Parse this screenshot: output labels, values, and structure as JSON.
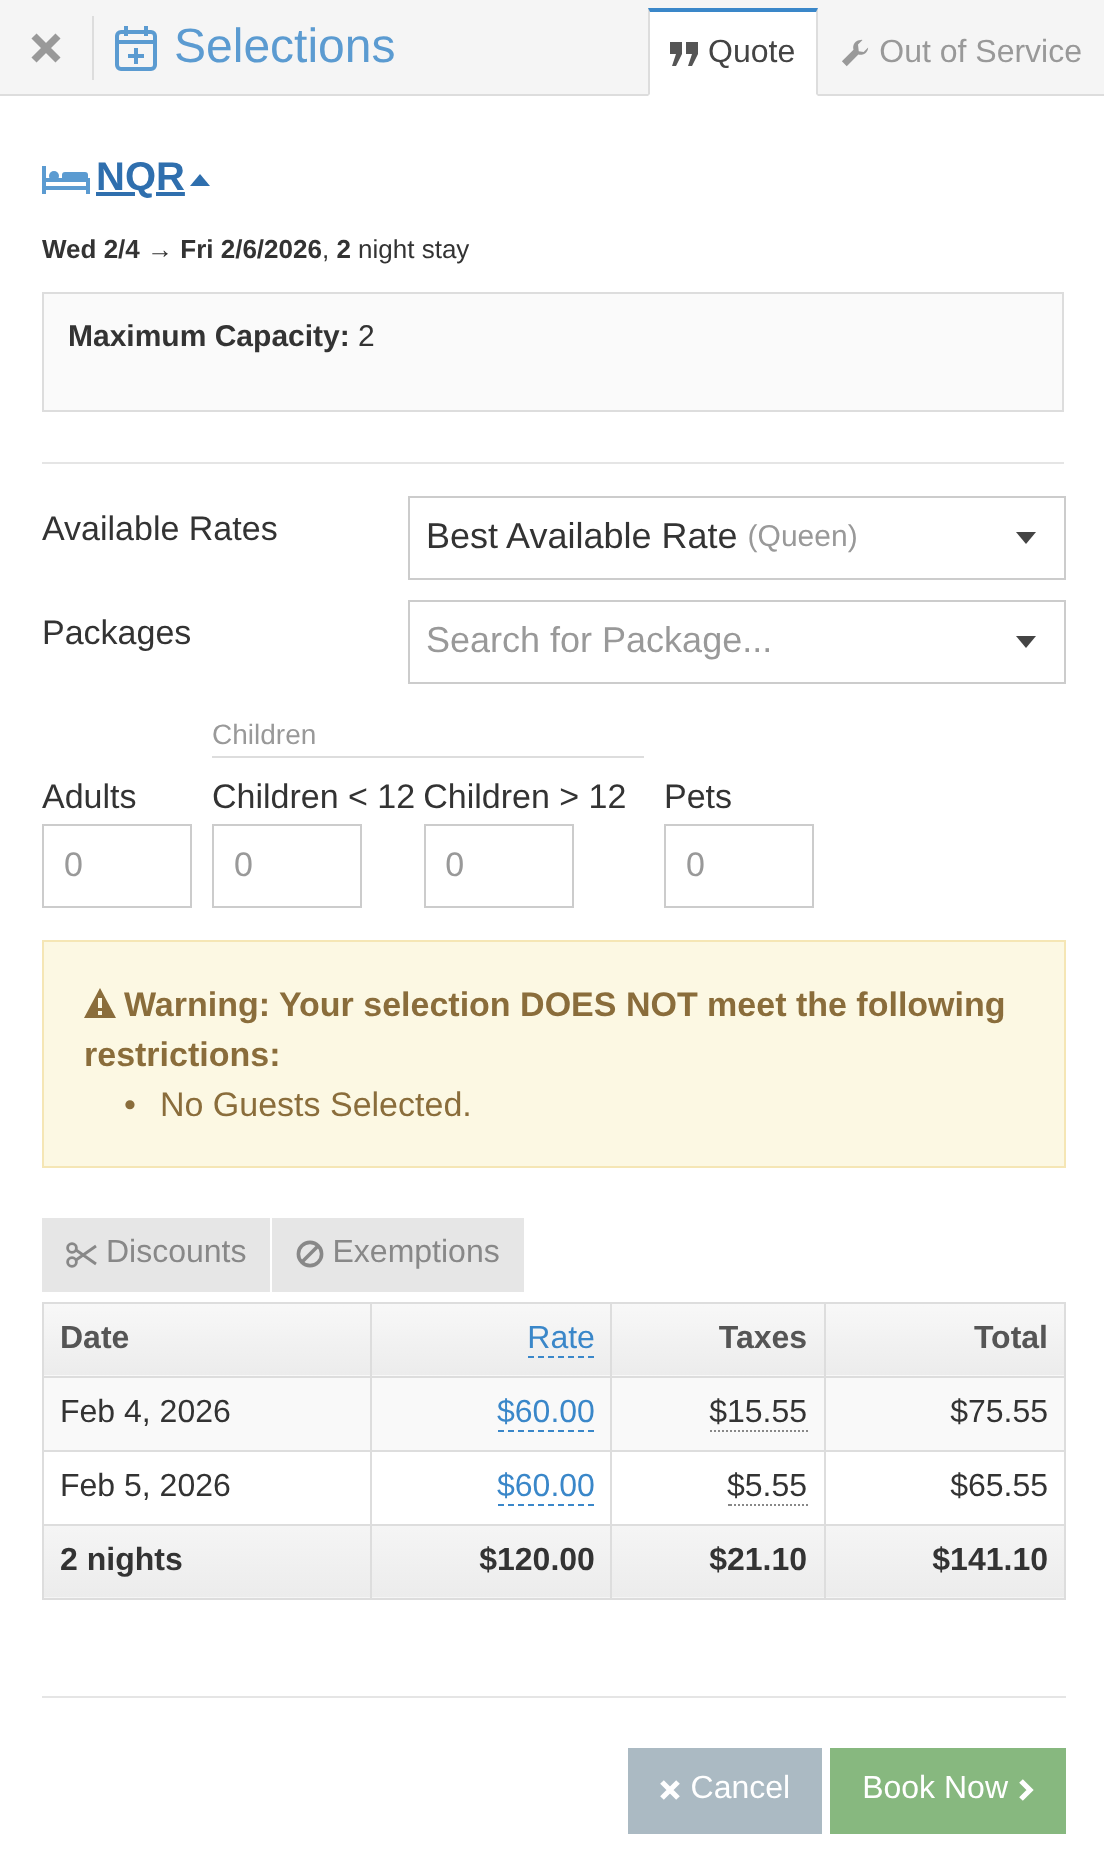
{
  "header": {
    "title": "Selections",
    "tabs": [
      {
        "label": "Quote",
        "selected": true
      },
      {
        "label": "Out of Service",
        "selected": false
      }
    ]
  },
  "room": {
    "name": "NQR",
    "expanded": true,
    "stay": "**Wed 2/4** → **Fri 2/6/2026**, **2** night stay",
    "capacity": "**Maximum Capacity:** 2"
  },
  "fields": [
    {
      "label": "Available Rates",
      "value": "Best Available Rate",
      "hint": "(Queen)"
    },
    {
      "label": "Packages",
      "placeholder": "Search for Package..."
    }
  ],
  "guests": [
    {
      "kind": "single",
      "label": "Adults",
      "placeholder": "0"
    },
    {
      "kind": "group",
      "label": "Children",
      "fields": [
        {
          "label": "Children < 12",
          "placeholder": "0"
        },
        {
          "label": "Children > 12",
          "placeholder": "0"
        }
      ]
    },
    {
      "kind": "single",
      "label": "Pets",
      "placeholder": "0"
    }
  ],
  "warning": {
    "title": "Warning: Your selection DOES NOT meet the following restrictions:",
    "items": [
      {
        "marker": "•",
        "text": "No Guests Selected."
      }
    ]
  },
  "adjust_tabs": [
    {
      "label": "Discounts"
    },
    {
      "label": "Exemptions"
    }
  ],
  "table": {
    "columns": [
      {
        "label": "Date",
        "kind": "plain"
      },
      {
        "label": "Rate",
        "kind": "link"
      },
      {
        "label": "Taxes",
        "kind": "dotted"
      },
      {
        "label": "Total",
        "kind": "plain"
      }
    ],
    "rows": [
      [
        "Feb 4, 2026",
        "$60.00",
        "$15.55",
        "$75.55"
      ],
      [
        "Feb 5, 2026",
        "$60.00",
        "$5.55",
        "$65.55"
      ]
    ],
    "footer": [
      "2 nights",
      "$120.00",
      "$21.10",
      "$141.10"
    ]
  },
  "buttons": [
    {
      "label": "Cancel",
      "kind": "cancel"
    },
    {
      "label": "Book Now",
      "kind": "primary"
    }
  ]
}
